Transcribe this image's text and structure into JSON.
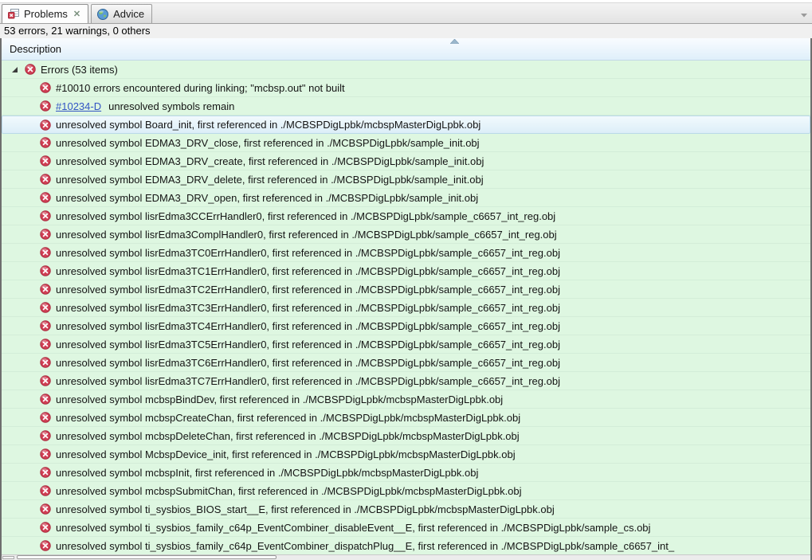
{
  "tabs": {
    "problems": {
      "label": "Problems"
    },
    "advice": {
      "label": "Advice"
    }
  },
  "icons": {
    "close_glyph": "✕"
  },
  "summary": "53 errors, 21 warnings, 0 others",
  "table": {
    "column_header": "Description",
    "sort_order": "ascending"
  },
  "colors": {
    "row_green": "#def7e1",
    "selection_blue": "#dceef8",
    "error_red": "#d04055",
    "link_blue": "#3355c4"
  },
  "tree": {
    "group_label": "Errors (53 items)",
    "group_expanded": true,
    "errors": [
      {
        "text": "#10010 errors encountered during linking; \"mcbsp.out\" not built"
      },
      {
        "link": "#10234-D",
        "text": "unresolved symbols remain"
      },
      {
        "text": "unresolved symbol Board_init, first referenced in ./MCBSPDigLpbk/mcbspMasterDigLpbk.obj",
        "selected": true
      },
      {
        "text": "unresolved symbol EDMA3_DRV_close, first referenced in ./MCBSPDigLpbk/sample_init.obj"
      },
      {
        "text": "unresolved symbol EDMA3_DRV_create, first referenced in ./MCBSPDigLpbk/sample_init.obj"
      },
      {
        "text": "unresolved symbol EDMA3_DRV_delete, first referenced in ./MCBSPDigLpbk/sample_init.obj"
      },
      {
        "text": "unresolved symbol EDMA3_DRV_open, first referenced in ./MCBSPDigLpbk/sample_init.obj"
      },
      {
        "text": "unresolved symbol lisrEdma3CCErrHandler0, first referenced in ./MCBSPDigLpbk/sample_c6657_int_reg.obj"
      },
      {
        "text": "unresolved symbol lisrEdma3ComplHandler0, first referenced in ./MCBSPDigLpbk/sample_c6657_int_reg.obj"
      },
      {
        "text": "unresolved symbol lisrEdma3TC0ErrHandler0, first referenced in ./MCBSPDigLpbk/sample_c6657_int_reg.obj"
      },
      {
        "text": "unresolved symbol lisrEdma3TC1ErrHandler0, first referenced in ./MCBSPDigLpbk/sample_c6657_int_reg.obj"
      },
      {
        "text": "unresolved symbol lisrEdma3TC2ErrHandler0, first referenced in ./MCBSPDigLpbk/sample_c6657_int_reg.obj"
      },
      {
        "text": "unresolved symbol lisrEdma3TC3ErrHandler0, first referenced in ./MCBSPDigLpbk/sample_c6657_int_reg.obj"
      },
      {
        "text": "unresolved symbol lisrEdma3TC4ErrHandler0, first referenced in ./MCBSPDigLpbk/sample_c6657_int_reg.obj"
      },
      {
        "text": "unresolved symbol lisrEdma3TC5ErrHandler0, first referenced in ./MCBSPDigLpbk/sample_c6657_int_reg.obj"
      },
      {
        "text": "unresolved symbol lisrEdma3TC6ErrHandler0, first referenced in ./MCBSPDigLpbk/sample_c6657_int_reg.obj"
      },
      {
        "text": "unresolved symbol lisrEdma3TC7ErrHandler0, first referenced in ./MCBSPDigLpbk/sample_c6657_int_reg.obj"
      },
      {
        "text": "unresolved symbol mcbspBindDev, first referenced in ./MCBSPDigLpbk/mcbspMasterDigLpbk.obj"
      },
      {
        "text": "unresolved symbol mcbspCreateChan, first referenced in ./MCBSPDigLpbk/mcbspMasterDigLpbk.obj"
      },
      {
        "text": "unresolved symbol mcbspDeleteChan, first referenced in ./MCBSPDigLpbk/mcbspMasterDigLpbk.obj"
      },
      {
        "text": "unresolved symbol McbspDevice_init, first referenced in ./MCBSPDigLpbk/mcbspMasterDigLpbk.obj"
      },
      {
        "text": "unresolved symbol mcbspInit, first referenced in ./MCBSPDigLpbk/mcbspMasterDigLpbk.obj"
      },
      {
        "text": "unresolved symbol mcbspSubmitChan, first referenced in ./MCBSPDigLpbk/mcbspMasterDigLpbk.obj"
      },
      {
        "text": "unresolved symbol ti_sysbios_BIOS_start__E, first referenced in ./MCBSPDigLpbk/mcbspMasterDigLpbk.obj"
      },
      {
        "text": "unresolved symbol ti_sysbios_family_c64p_EventCombiner_disableEvent__E, first referenced in ./MCBSPDigLpbk/sample_cs.obj"
      },
      {
        "text": "unresolved symbol ti_sysbios_family_c64p_EventCombiner_dispatchPlug__E, first referenced in ./MCBSPDigLpbk/sample_c6657_int_"
      }
    ]
  }
}
